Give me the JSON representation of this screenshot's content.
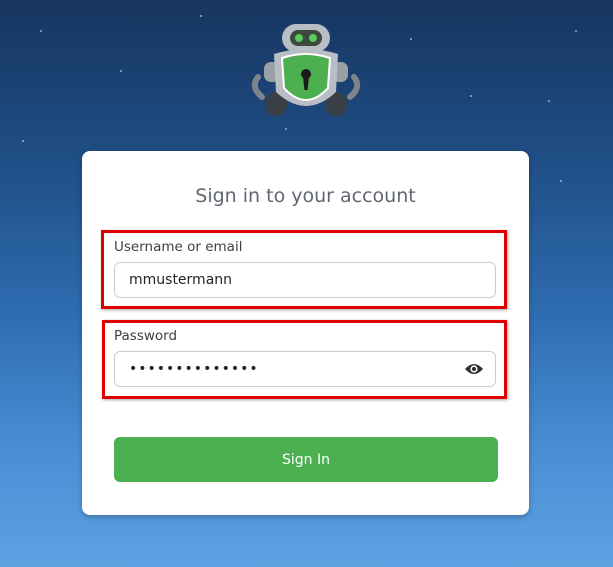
{
  "login": {
    "title": "Sign in to your account",
    "username_label": "Username or email",
    "username_value": "mmustermann",
    "password_label": "Password",
    "password_value": "••••••••••••••",
    "submit_label": "Sign In"
  },
  "colors": {
    "primary_button": "#4caf50",
    "highlight": "#e00000",
    "background_top": "#173560",
    "background_bottom": "#5ea2e2"
  },
  "icons": {
    "logo": "robot-shield-lock-logo",
    "password_toggle": "eye-icon"
  }
}
